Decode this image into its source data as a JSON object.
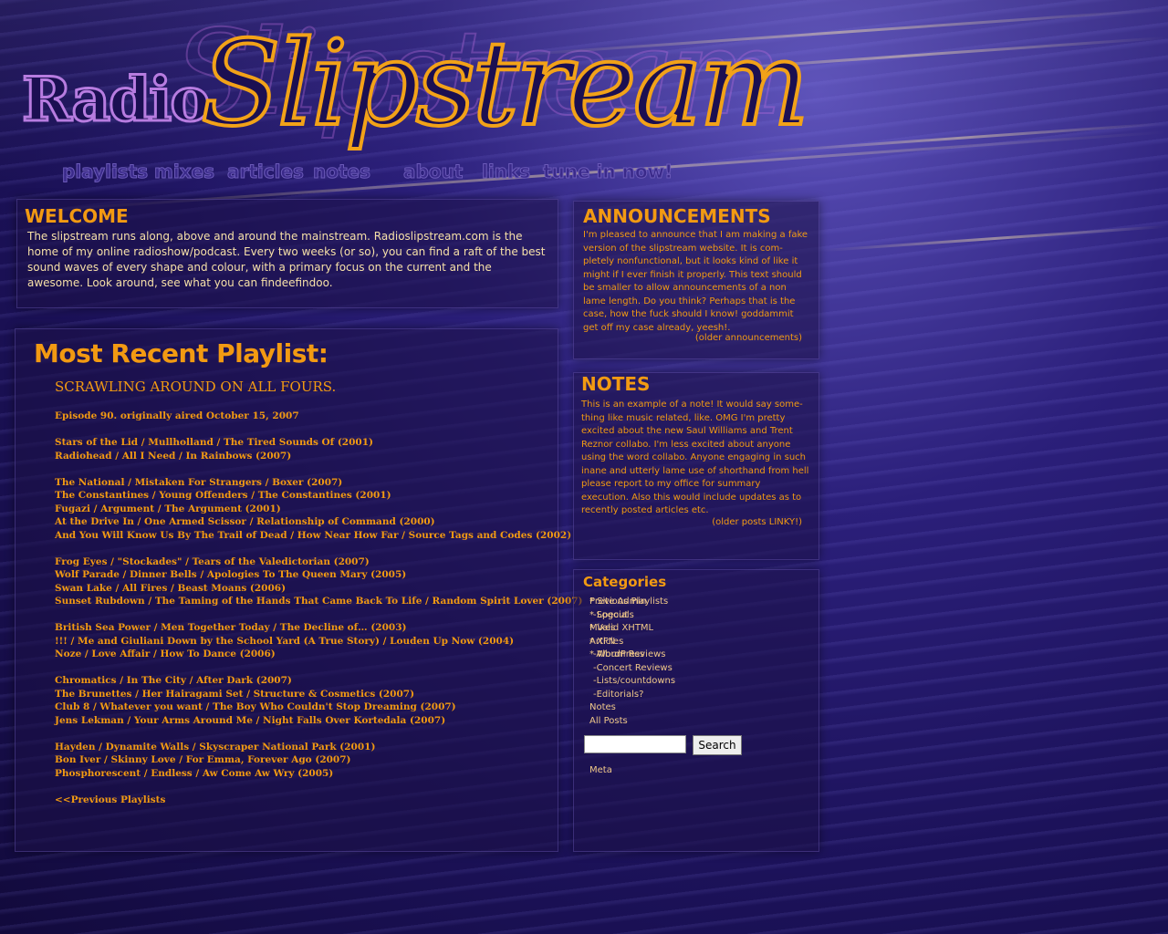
{
  "header": {
    "logo_radio": "Radio",
    "logo_slipstream": "Slipstream"
  },
  "nav": {
    "items": [
      "playlists",
      "mixes",
      "articles",
      "notes",
      "about",
      "links",
      "tune in now!"
    ]
  },
  "welcome": {
    "title": "WELCOME",
    "body": "The slipstream runs along, above and around the mainstream. Radioslipstream.com is the home of my online radioshow/podcast. Every two weeks (or so), you can find  a raft of the best sound waves of every shape and colour, with a primary focus on the current and the awesome. Look around, see what you can findeefindoo."
  },
  "playlist": {
    "heading": "Most Recent Playlist:",
    "title": "SCRAWLING AROUND ON ALL FOURS.",
    "groups": [
      [
        "Episode 90. originally aired October 15, 2007"
      ],
      [
        "Stars of the Lid / Mullholland / The Tired Sounds Of (2001)",
        "Radiohead / All I Need / In Rainbows (2007)"
      ],
      [
        "The National / Mistaken For Strangers / Boxer (2007)",
        "The Constantines / Young Offenders / The Constantines (2001)",
        "Fugazi / Argument / The Argument (2001)",
        "At the Drive In / One Armed Scissor / Relationship of Command (2000)",
        "And You Will Know Us By The Trail of Dead / How Near How Far / Source Tags and Codes (2002)"
      ],
      [
        "Frog Eyes / \"Stockades\" / Tears of the Valedictorian (2007)",
        "Wolf Parade / Dinner Bells / Apologies To The Queen Mary (2005)",
        "Swan Lake / All Fires / Beast Moans (2006)",
        "Sunset Rubdown / The Taming of the Hands That Came Back To Life / Random Spirit Lover (2007)"
      ],
      [
        "British Sea Power / Men Together Today / The Decline of… (2003)",
        "!!! / Me and Giuliani Down by the School Yard (A True Story) / Louden Up Now (2004)",
        "Noze / Love Affair / How To Dance (2006)"
      ],
      [
        "Chromatics / In The City / After Dark (2007)",
        "The Brunettes / Her Hairagami Set / Structure & Cosmetics (2007)",
        "Club 8 / Whatever you want / The Boy Who Couldn't Stop Dreaming (2007)",
        "Jens Lekman / Your Arms Around Me / Night Falls Over Kortedala (2007)"
      ],
      [
        "Hayden / Dynamite Walls / Skyscraper National Park (2001)",
        "Bon Iver / Skinny Love / For Emma, Forever Ago (2007)",
        "Phosphorescent / Endless / Aw Come Aw Wry (2005)"
      ],
      [
        "<<Previous Playlists"
      ]
    ]
  },
  "announcements": {
    "title": "ANNOUNCEMENTS",
    "body": "I'm pleased to announce that I am making a fake version of the slipstream website. It is com-pletely nonfunctional, but it looks kind of like it might if I ever finish it properly. This text should be smaller to allow announcements of a non lame length. Do you think? Perhaps that is the case, how the fuck should I know! goddammit get off my case already, yeesh!.",
    "older_link": "(older announcements)"
  },
  "notes": {
    "title": "NOTES",
    "body": "This is an example of a note! It would say some-thing like music related, like. OMG I'm pretty excited about the new Saul Williams and Trent Reznor collabo. I'm less excited about anyone using the word collabo. Anyone engaging in such inane and utterly lame use of shorthand from hell please report to my office for summary execution. Also this would include updates as to recently posted articles etc.",
    "older_link": "(older posts LINKY!)"
  },
  "categories": {
    "title": "Categories",
    "items": [
      "Previous Playlists",
      "-Specials",
      "Mixes",
      "Articles",
      "-Album Reviews",
      "-Concert Reviews",
      "-Lists/countdowns",
      "-Editorials?",
      "Notes",
      "All Posts"
    ],
    "search_value": "",
    "search_button": "Search",
    "meta_title": "Meta",
    "meta_items": [
      "* Site Admin",
      "* Logout",
      "* Valid XHTML",
      "* XFN",
      "* WordPress"
    ]
  }
}
